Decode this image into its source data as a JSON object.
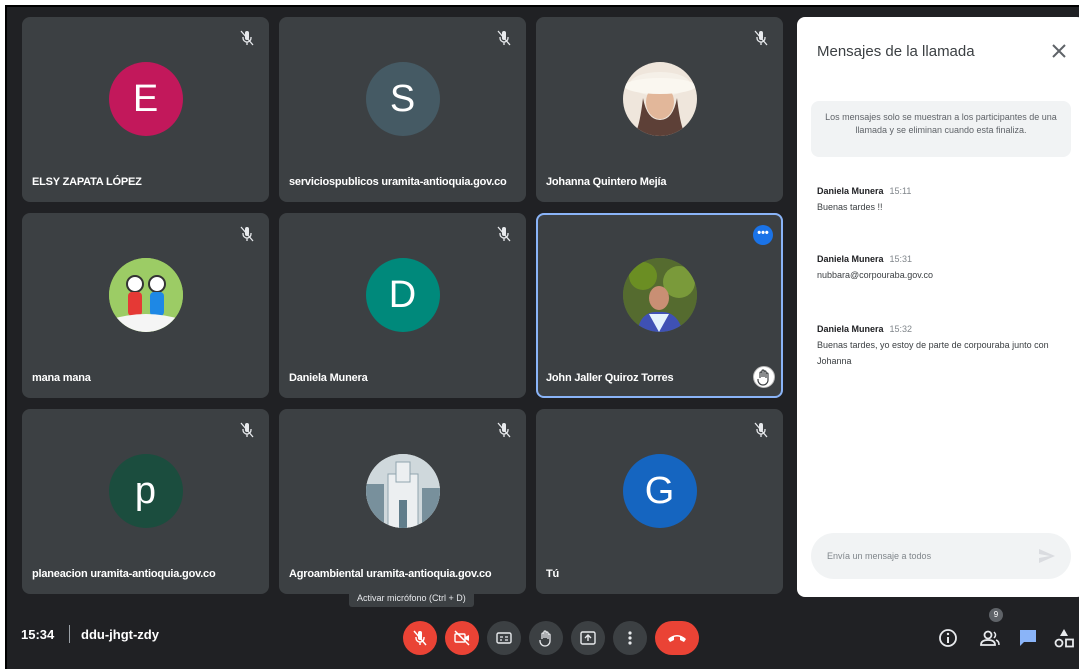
{
  "tiles": [
    {
      "name": "ELSY ZAPATA LÓPEZ",
      "initial": "E",
      "avatar_color": "#c2185b",
      "type": "initial"
    },
    {
      "name": "serviciospublicos uramita-antioquia.gov.co",
      "initial": "S",
      "avatar_color": "#455a64",
      "type": "initial"
    },
    {
      "name": "Johanna Quintero Mejía",
      "initial": "",
      "avatar_color": "#d7ccc8",
      "type": "photo"
    },
    {
      "name": "mana mana",
      "initial": "",
      "avatar_color": "#7cb342",
      "type": "photo"
    },
    {
      "name": "Daniela Munera",
      "initial": "D",
      "avatar_color": "#00897b",
      "type": "initial"
    },
    {
      "name": "John Jaller Quiroz Torres",
      "initial": "",
      "avatar_color": "#5d7a5a",
      "type": "photo"
    },
    {
      "name": "planeacion uramita-antioquia.gov.co",
      "initial": "p",
      "avatar_color": "#1b4d3e",
      "type": "initial"
    },
    {
      "name": "Agroambiental uramita-antioquia.gov.co",
      "initial": "",
      "avatar_color": "#9e9e9e",
      "type": "photo"
    },
    {
      "name": "Tú",
      "initial": "G",
      "avatar_color": "#1565c0",
      "type": "initial"
    }
  ],
  "chat": {
    "title": "Mensajes de la llamada",
    "notice": "Los mensajes solo se muestran a los participantes de una llamada y se eliminan cuando esta finaliza.",
    "messages": [
      {
        "author": "Daniela Munera",
        "time": "15:11",
        "text": "Buenas tardes !!"
      },
      {
        "author": "Daniela Munera",
        "time": "15:31",
        "text": "nubbara@corpouraba.gov.co"
      },
      {
        "author": "Daniela Munera",
        "time": "15:32",
        "text": "Buenas tardes, yo estoy de parte de corpouraba junto con Johanna"
      }
    ],
    "input_placeholder": "Envía un mensaje a todos"
  },
  "bottombar": {
    "time": "15:34",
    "meeting_code": "ddu-jhgt-zdy",
    "tooltip": "Activar micrófono (Ctrl + D)",
    "participants_count": "9"
  },
  "colors": {
    "background": "#202124",
    "tile": "#3c4043",
    "accent_red": "#ea4335",
    "accent_blue": "#1a73e8"
  }
}
